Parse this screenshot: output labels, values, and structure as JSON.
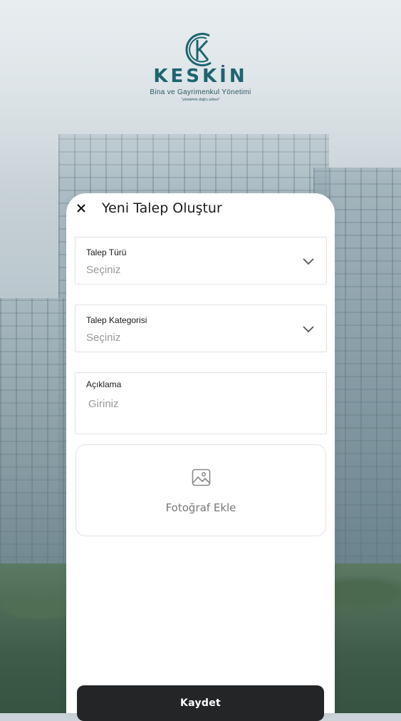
{
  "brand": {
    "name": "KESKİN",
    "subtitle": "Bina ve Gayrimenkul Yönetimi",
    "tagline": "\"yönetimin doğru adresi\"",
    "color": "#1d6470"
  },
  "sheet": {
    "title": "Yeni Talep Oluştur",
    "close_icon": "close-icon"
  },
  "fields": {
    "request_type": {
      "label": "Talep Türü",
      "placeholder": "Seçiniz",
      "icon": "chevron-down-icon"
    },
    "request_category": {
      "label": "Talep Kategorisi",
      "placeholder": "Seçiniz",
      "icon": "chevron-down-icon"
    },
    "description": {
      "label": "Açıklama",
      "placeholder": "Giriniz"
    }
  },
  "photo": {
    "label": "Fotoğraf Ekle",
    "icon": "image-icon"
  },
  "actions": {
    "save_label": "Kaydet",
    "save_color": "#232527"
  }
}
